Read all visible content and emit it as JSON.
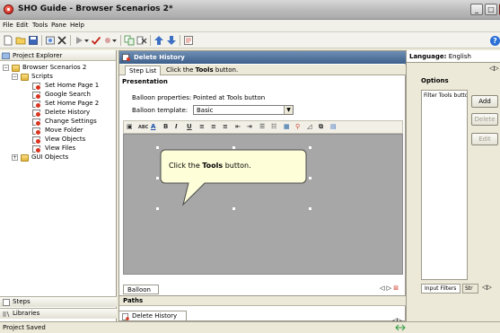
{
  "window": {
    "title": "SHO Guide - Browser Scenarios 2*"
  },
  "menu": [
    "File",
    "Edit",
    "Tools",
    "Pane",
    "Help"
  ],
  "project_explorer": {
    "title": "Project Explorer",
    "root": "Browser Scenarios 2",
    "scripts_folder": "Scripts",
    "scripts": [
      "Set Home Page 1",
      "Google Search",
      "Set Home Page 2",
      "Delete History",
      "Change Settings",
      "Move Folder",
      "View Objects",
      "View Files"
    ],
    "gui_folder": "GUI Objects",
    "bottom_tabs": [
      "Steps",
      "Libraries"
    ]
  },
  "editor": {
    "title": "Delete History",
    "step_tab": "Step List",
    "step_text_prefix": "Click the ",
    "step_text_bold": "Tools",
    "step_text_suffix": " button.",
    "presentation_label": "Presentation",
    "balloon_properties_label": "Balloon properties:",
    "balloon_properties_value": "Pointed at Tools button",
    "balloon_template_label": "Balloon template:",
    "balloon_template_value": "Basic",
    "balloon_text_prefix": "Click the ",
    "balloon_text_bold": "Tools",
    "balloon_text_suffix": " button.",
    "balloon_tab": "Balloon",
    "paths_label": "Paths",
    "document_tab": "Delete History"
  },
  "options_panel": {
    "language_label": "Language:",
    "language_value": "English",
    "options_label": "Options",
    "filter_item": "Filter Tools butto",
    "buttons": {
      "add": "Add",
      "delete": "Delete",
      "edit": "Edit"
    },
    "tabs": {
      "input_filters": "Input Filters",
      "str": "Str"
    }
  },
  "status": {
    "text": "Project Saved"
  }
}
